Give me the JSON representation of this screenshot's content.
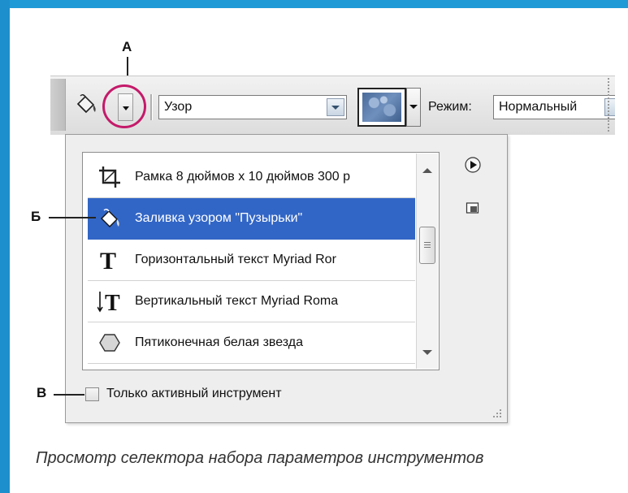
{
  "annotations": {
    "a": "А",
    "b": "Б",
    "v": "В"
  },
  "options_bar": {
    "fill_value": "Узор",
    "mode_label": "Режим:",
    "mode_value": "Нормальный"
  },
  "preset_list": {
    "items": [
      {
        "icon": "crop-icon",
        "label": "Рамка 8 дюймов x 10 дюймов 300 р",
        "selected": false
      },
      {
        "icon": "paint-bucket-icon",
        "label": "Заливка узором \"Пузырьки\"",
        "selected": true
      },
      {
        "icon": "horizontal-type-icon",
        "label": "Горизонтальный текст Myriad Ror",
        "selected": false
      },
      {
        "icon": "vertical-type-icon",
        "label": "Вертикальный текст Myriad Roma",
        "selected": false
      },
      {
        "icon": "polygon-icon",
        "label": "Пятиконечная белая звезда",
        "selected": false
      }
    ]
  },
  "active_only": {
    "label": "Только активный инструмент",
    "checked": false
  },
  "caption": "Просмотр селектора набора параметров инструментов",
  "colors": {
    "slide_frame": "#1f9ad6",
    "selection": "#3266c6",
    "highlight_circle": "#c41a6a"
  }
}
